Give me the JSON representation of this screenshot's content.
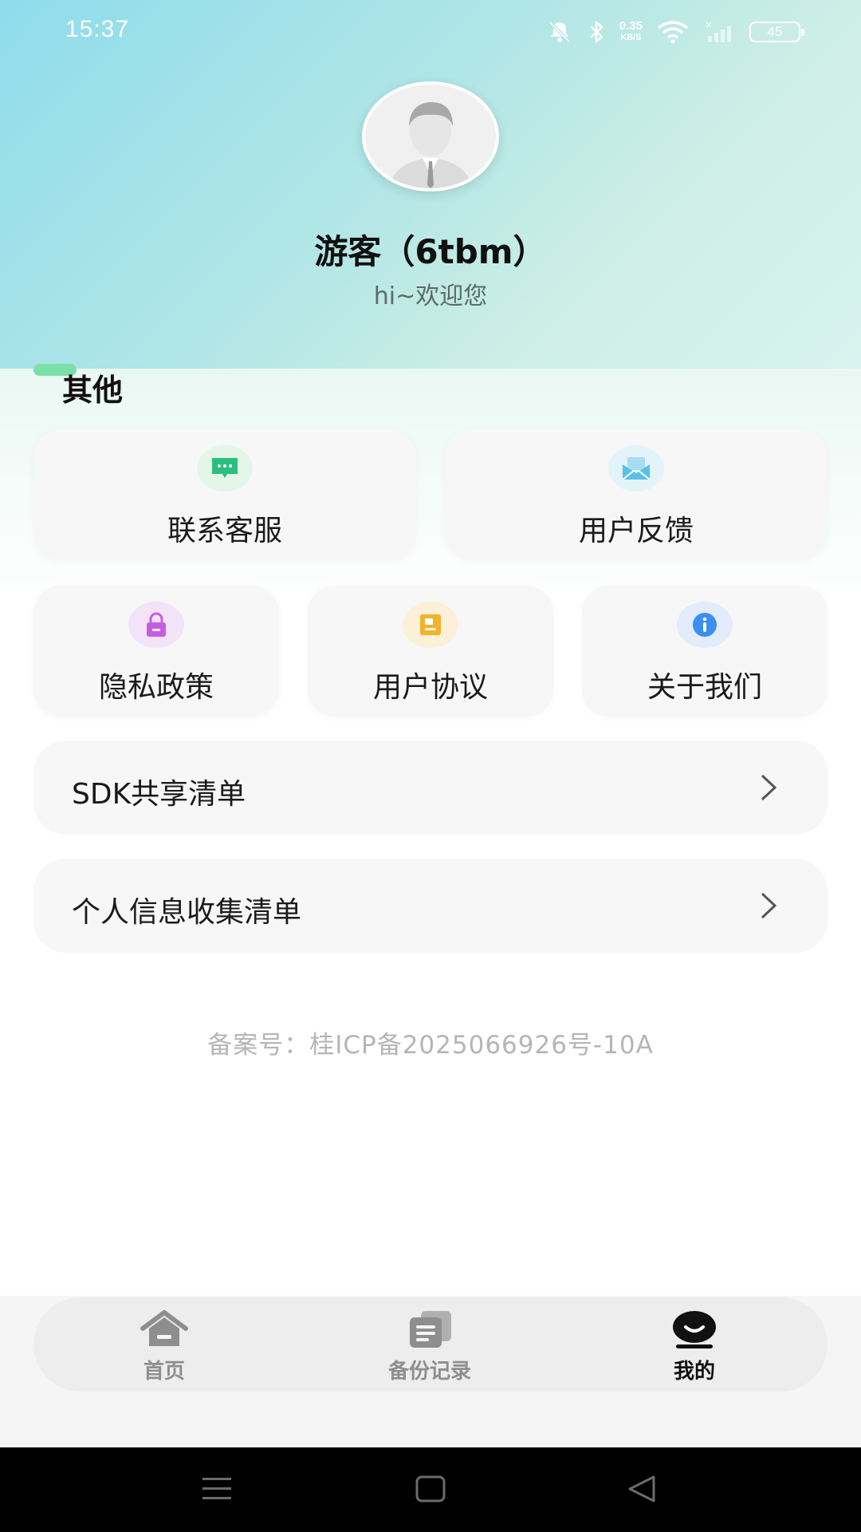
{
  "status_bar": {
    "time": "15:37",
    "speed_value": "0.35",
    "speed_unit": "KB/S",
    "battery": "45"
  },
  "profile": {
    "name": "游客（6tbm）",
    "greeting": "hi~欢迎您"
  },
  "section": {
    "title": "其他"
  },
  "grid_top": [
    {
      "label": "联系客服",
      "icon": "chat-icon",
      "color": "#2bbf7d"
    },
    {
      "label": "用户反馈",
      "icon": "mail-icon",
      "color": "#5cc0e6"
    }
  ],
  "grid_bottom": [
    {
      "label": "隐私政策",
      "icon": "lock-icon",
      "color": "#c65ee0"
    },
    {
      "label": "用户协议",
      "icon": "document-icon",
      "color": "#f4b12a"
    },
    {
      "label": "关于我们",
      "icon": "info-icon",
      "color": "#3a8ff0"
    }
  ],
  "list": [
    {
      "label": "SDK共享清单"
    },
    {
      "label": "个人信息收集清单"
    }
  ],
  "icp": "备案号：桂ICP备2025066926号-10A",
  "nav": [
    {
      "label": "首页",
      "icon": "home-icon",
      "active": false
    },
    {
      "label": "备份记录",
      "icon": "backup-records-icon",
      "active": false
    },
    {
      "label": "我的",
      "icon": "profile-icon",
      "active": true
    }
  ],
  "colors": {
    "header_start": "#8fdcec",
    "header_end": "#d9f3ef",
    "nav_inactive": "#8e8e8e",
    "nav_active": "#111111",
    "accent": "#7be0a8"
  }
}
